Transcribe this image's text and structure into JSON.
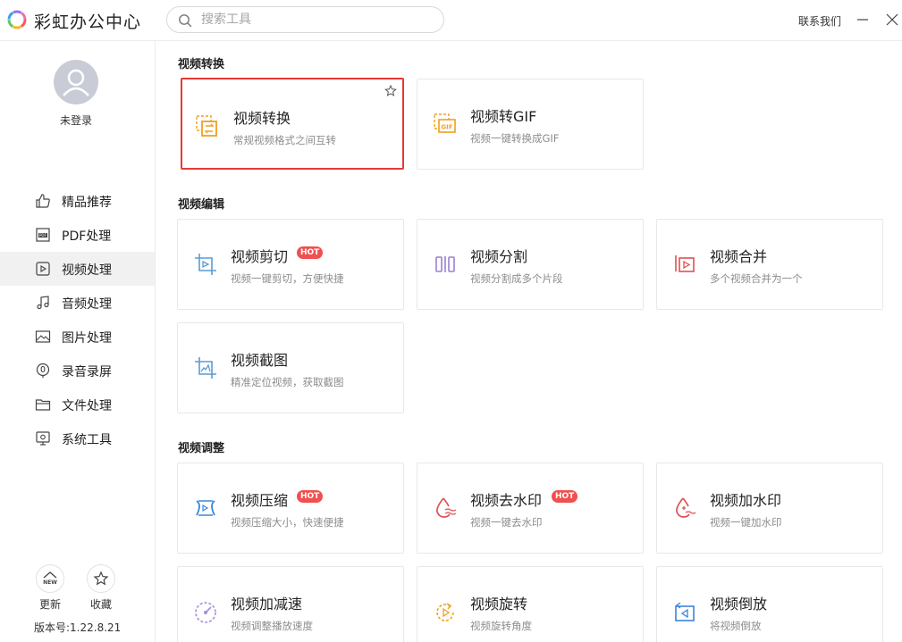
{
  "app": {
    "title": "彩虹办公中心"
  },
  "search": {
    "placeholder": "搜索工具"
  },
  "header": {
    "contact_label": "联系我们"
  },
  "user": {
    "login_label": "未登录"
  },
  "sidebar": {
    "items": [
      {
        "label": "精品推荐",
        "icon": "thumbs-up-icon"
      },
      {
        "label": "PDF处理",
        "icon": "pdf-icon"
      },
      {
        "label": "视频处理",
        "icon": "video-play-icon",
        "active": true
      },
      {
        "label": "音频处理",
        "icon": "music-note-icon"
      },
      {
        "label": "图片处理",
        "icon": "image-icon"
      },
      {
        "label": "录音录屏",
        "icon": "microphone-icon"
      },
      {
        "label": "文件处理",
        "icon": "folder-icon"
      },
      {
        "label": "系统工具",
        "icon": "monitor-gear-icon"
      }
    ],
    "update_label": "更新",
    "update_badge": "NEW",
    "favorite_label": "收藏",
    "version": "版本号:1.22.8.21"
  },
  "sections": [
    {
      "title": "视频转换",
      "cards": [
        {
          "title": "视频转换",
          "desc": "常规视频格式之间互转",
          "icon": "video-convert-icon",
          "selected": true
        },
        {
          "title": "视频转GIF",
          "desc": "视频一键转换成GIF",
          "icon": "gif-icon"
        }
      ]
    },
    {
      "title": "视频编辑",
      "cards": [
        {
          "title": "视频剪切",
          "desc": "视频一键剪切，方便快捷",
          "icon": "crop-icon",
          "hot": "HOT"
        },
        {
          "title": "视频分割",
          "desc": "视频分割成多个片段",
          "icon": "split-icon"
        },
        {
          "title": "视频合并",
          "desc": "多个视频合并为一个",
          "icon": "merge-icon"
        },
        {
          "title": "视频截图",
          "desc": "精准定位视频，获取截图",
          "icon": "screenshot-icon"
        }
      ]
    },
    {
      "title": "视频调整",
      "cards": [
        {
          "title": "视频压缩",
          "desc": "视频压缩大小，快速便捷",
          "icon": "compress-icon",
          "hot": "HOT"
        },
        {
          "title": "视频去水印",
          "desc": "视频一键去水印",
          "icon": "remove-watermark-icon",
          "hot": "HOT"
        },
        {
          "title": "视频加水印",
          "desc": "视频一键加水印",
          "icon": "add-watermark-icon"
        },
        {
          "title": "视频加减速",
          "desc": "视频调整播放速度",
          "icon": "speedometer-icon"
        },
        {
          "title": "视频旋转",
          "desc": "视频旋转角度",
          "icon": "rotate-icon"
        },
        {
          "title": "视频倒放",
          "desc": "将视频倒放",
          "icon": "reverse-icon"
        }
      ]
    }
  ],
  "colors": {
    "accent_red": "#e53935",
    "hot_badge": "#f0504f",
    "orange_icon": "#f0a020",
    "blue_icon": "#5b9bd5"
  }
}
